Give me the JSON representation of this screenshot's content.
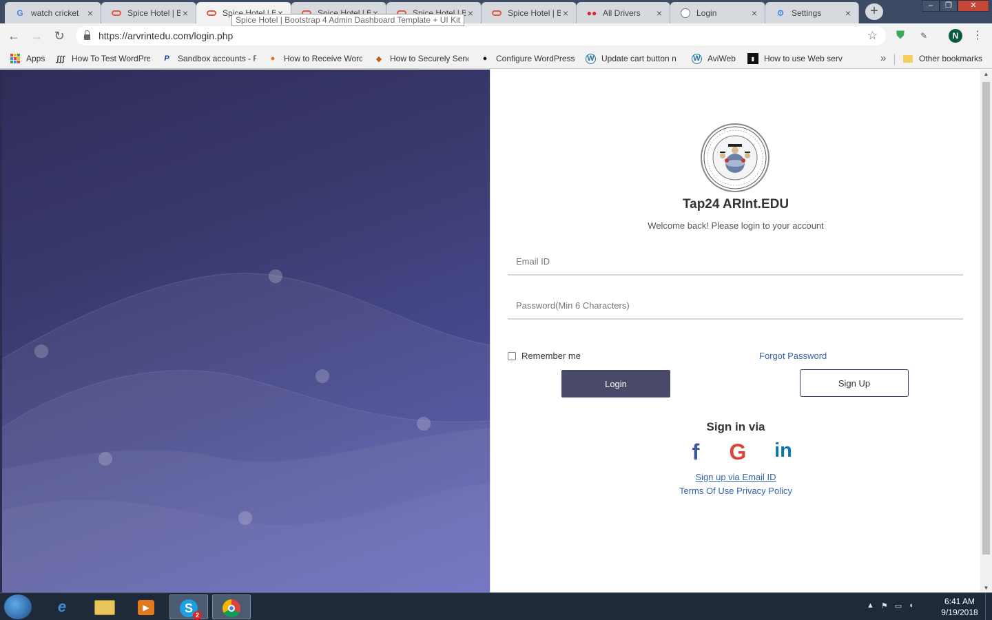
{
  "browser": {
    "tabs": [
      {
        "title": "watch cricket",
        "icon": "google-icon",
        "active": false
      },
      {
        "title": "Spice Hotel | Bo",
        "icon": "spice-icon",
        "active": false
      },
      {
        "title": "Spice Hotel | Bo",
        "icon": "spice-icon",
        "active": true
      },
      {
        "title": "Spice Hotel | Bo",
        "icon": "spice-icon",
        "active": false
      },
      {
        "title": "Spice Hotel | Bo",
        "icon": "spice-icon",
        "active": false
      },
      {
        "title": "Spice Hotel | Bo",
        "icon": "spice-icon",
        "active": false
      },
      {
        "title": "All Drivers",
        "icon": "drivers-icon",
        "active": false
      },
      {
        "title": "Login",
        "icon": "login-icon",
        "active": false
      },
      {
        "title": "Settings",
        "icon": "gear-icon",
        "active": false
      }
    ],
    "tooltip": "Spice Hotel | Bootstrap 4 Admin Dashboard Template + UI Kit",
    "url": "https://arvrintedu.com/login.php",
    "profile_initial": "N",
    "bookmarks": [
      {
        "label": "Apps"
      },
      {
        "label": "How To Test WordPre"
      },
      {
        "label": "Sandbox accounts - P"
      },
      {
        "label": "How to Receive Word"
      },
      {
        "label": "How to Securely Send"
      },
      {
        "label": "Configure WordPress"
      },
      {
        "label": "Update cart button n"
      },
      {
        "label": "AviWeb"
      },
      {
        "label": "How to use Web serv"
      }
    ],
    "other_bookmarks": "Other bookmarks"
  },
  "login": {
    "brand": "Tap24 ARInt.EDU",
    "welcome": "Welcome back! Please login to your account",
    "email_placeholder": "Email ID",
    "password_placeholder": "Password(Min 6 Characters)",
    "remember_label": "Remember me",
    "forgot_label": "Forgot Password",
    "login_button": "Login",
    "signup_button": "Sign Up",
    "signin_via": "Sign in via",
    "social": {
      "facebook": "f",
      "google": "G",
      "linkedin": "in"
    },
    "signup_email": "Sign up via Email ID",
    "legal": "Terms Of Use Privacy Policy"
  },
  "taskbar": {
    "skype_badge": "2",
    "time": "6:41 AM",
    "date": "9/19/2018"
  },
  "colors": {
    "hero_start": "#2e2c58",
    "hero_end": "#5a5bb8",
    "login_button": "#494a6a",
    "link": "#3463a6",
    "facebook": "#3b5998",
    "google": "#dc4437",
    "linkedin": "#0e76a8"
  }
}
